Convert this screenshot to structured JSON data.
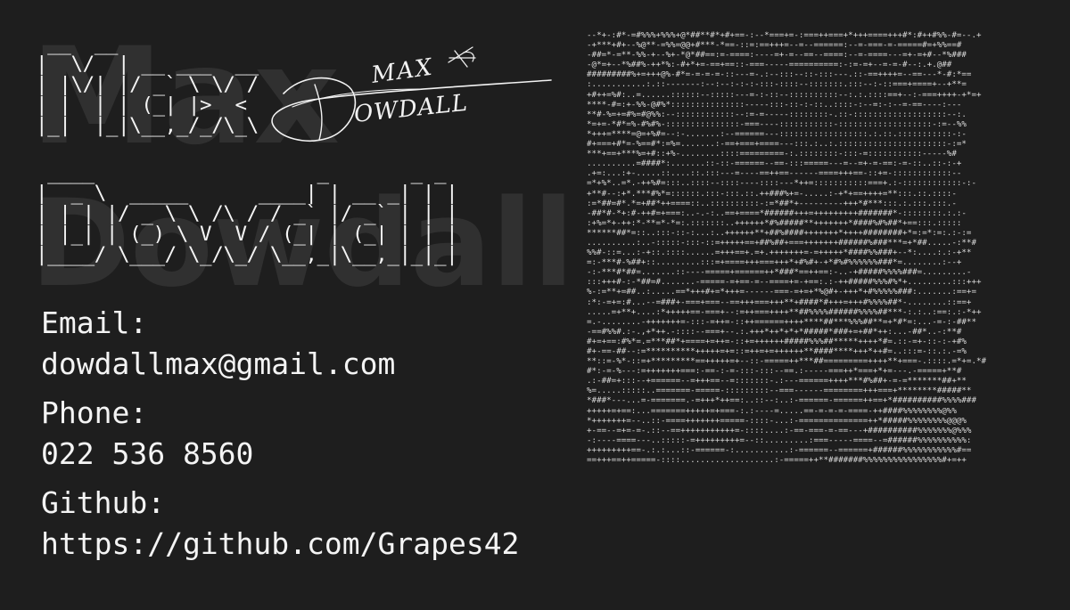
{
  "ascii_first_name": " __  __\n|  \\/  | __ ___  __\n| |\\/| |/ _` \\ \\/ /\n| |  | | (_| |>  <\n|_|  |_|\\__,_/_/\\_\\",
  "ascii_last_name": " ____                   _       _ _\n|  _ \\  _____      ____| | __ _| | |\n| | | |/ _ \\ \\ /\\ / / _` |/ _` | | |\n| |_| | (_) \\ V  V / (_| | (_| | | |\n|____/ \\___/ \\_/\\_/ \\__,_|\\__,_|_|_|",
  "ghost_first": "Max",
  "ghost_last": "Dowdall",
  "signature_text": {
    "top": "MAX",
    "bottom": "OWDALL"
  },
  "contact": {
    "email_label": "Email:",
    "email_value": "dowdallmax@gmail.com",
    "phone_label": "Phone:",
    "phone_value": "022 536 8560",
    "github_label": "Github:",
    "github_value": "https://github.com/Grapes42"
  },
  "ascii_portrait": "--*+-:#*-=#%%%+%%%+@*##**#*+#+==-:--*===+=-:===++===+*+++====+++#*:#++#%%-#=--.+\n-+***+#+--%@**-=%%=@@+#***-*==-::=:==+++=--=--======:--=-===-=-=====#=+%%==#\n-##=*-=**-%%-+--%+-*@*##==:=-====:----=+-=--==--====:--=-====---=+-=+#--*%###\n-@*=+--*%##%-++*%:-#+*+=-==+==::-===-----==========:-:=-=+--=-=-#--:.+.@##\n#########%+=+++@%-#*=-=-=-=-::---=-.:--:::--::-:::---.::-==++++=--==---*-#:*==\n:...........:.::-------:--:--:-:-:-:::-::::--:::::::.:::--:-::===+====+--+**=\n+#++=%#:..=......::::::--:::::---=-:-::--::::::::::--:.:.::::==+--:-===++++-+*=+\n****-#=:+-%%-@#%*:::::::::::::::-----:::-::-:-::..::::-:--=:-:--=-==----:---\n**#-%=+=#%=#@%%:--::::::::::::--:=-=-----::::::::-.::-:::::::::::::::::::--:.\n*=+=-*#*=%-#%#%-:::::::::::::::-===----:::::::::::-:::::::::::::::::::-:=--%%\n*+++=****=@=+%#=--:-.......:--======---::::::::::::::::::.:.::.:::::::::::-:-\n#+===+#*=-%==#*:=%=.......:-==+===+====---:::.:..:.::::::::::::::::::::::-:=*\n***+==+***%=+#::+%-........::::=========-:.::::::::-:::-=:::::::::::-----%#\n..........=####*:.......::-::-======--==-:::=====---=--=+-=-==:-=-::..::-:-+\n.+=:...:+-.....::....::.:::---=----==++==------====+++==-::+=-::::::::::::--\n=*+%*..=*.-++%#=:::..::::--::::----::::---*++=:::::::::::===+.:-::::::::::::-:-\n+**#--:+*.***#%*=::::::.:::-:::.::.++###%+=-.....:-+*+==++++=**:::.::.::::-\n:=*##=#*.*=+##*++====::..::::::::::-:=*##*+---------+++*#***:::.:.:::.:::.-\n-##*#-*+:#-++#=+===:..-.-:..==+====*######+++=+++++++++#######*-::::::::.:.:-\n:+%=*+-++:*-**=*-*=:.:::::::..++++++*#%#####**+++++++*####%#%##*+==:::.:::::\n******##*=::..:::-::-:...:..++++++**+##%####+++++++*++++########+*=:=*:=:.:-:=\n..........:..-:::::-:::-::=+++++==+##%##+===+++++++######%###***=+*##.....-:**#\n%%#-::=...:-+::.::::......=+++==+.=+.+++++++=-=+++++*####%%###+--*:....:.:-+**\n=:-***#-%##+::.........:::=+====+++===+++*+#%#+-+*#%#%%%%%%###*=........:--+\n-:-***#*##=.......::----=====+======++*###*==++==:-..-+#####%%%%###=.........-\n:::+++#-:-*##=#.......-=====-=+==-=--====+=-+==:.:-++#####%%%#%*+.........:::+++\n%-:=**+=##..:.....==*+++#+=*+++=------===-=+=+*%@#+-+++*+#%%%%%###:.......:==+=\n:*:-=+=:#...--=###+-===+===--==+++===+++**+####*#+++=+++#%%%%##*-........::==+\n.....=+**+....:*+++++==-===+--:=++===++++**##%%%%######%%%%##***-:.:..:==:.:-*++\n=.-........-+++++++=-:::-=++=-::++======++++****##***%%%##**=+*#*=:...-=-:-##**\n-==#%%#.:-.,+*++.-::::--===+--.:.+++*++*+*+*#####*###+=+##*++:...-##*..-:**#\n#+=+==:#%*=.=***##*+====+=++=-::+=++++++#####%%%##*****++++*#=.::-=+-::-:-+#%\n#+-==-##--:=**********+++++=+=::=++=+=++++++**####****+++*++#=..:::=-::.:.-=%\n**::=-%*-::=+*********==+++++=+--::-=====++***##=========++++**+===-.::::.=*+=.*#\n#*:-=-%---:=+++++++===:-==-:-=-:::-:::--==.:-----===++*===+*+=---.-=====+**#\n.:-##=+:::--+======--=+++==--=:::::::-.:---======++++***#%##+-=-=*******##+**\n%=.....:::::..=======-=====-:::::::::--===------========+++===+********#####**\n*###*---...=-=======.-=+++*++==:..::--:..:-======-======++==+*##########%%%%###\n+++++=+==:...=======+++++=+===-:.:----=.....==-=-=-=-====-++####%%%%%%%%@%%\n*+++++++=--..::-====+++++++=====-::::-...:-==============++*#####%%%%%%%%@@@%\n+-==--=+=-=-.::--==+++++++++++=-::::....:-==-===-=-==---+##########%%%%%%%@%%%\n-:----====---..:::::-=+++++++++=--::.........:===-----====--=######%%%%%%%%%%:\n+++++++++==-.:.:...::-======-:...........:-======--======+######%%%%%%%%%%%#==\n==+++==++=====-::::...................:-=====++**#######%%%%%%%%%%%%%%%%#+=++"
}
